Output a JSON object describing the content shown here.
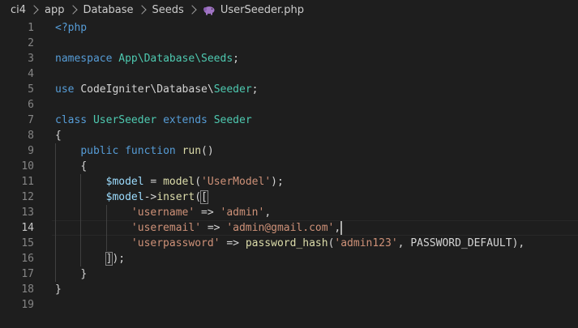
{
  "breadcrumb": {
    "items": [
      "ci4",
      "app",
      "Database",
      "Seeds"
    ],
    "file": "UserSeeder.php",
    "file_icon": "php-elephant-icon"
  },
  "colors": {
    "background": "#1e1e1e",
    "keyword": "#569cd6",
    "type": "#4ec9b0",
    "function": "#dcdcaa",
    "variable": "#9cdcfe",
    "string": "#ce9178",
    "text": "#d4d4d4",
    "line_number": "#858585"
  },
  "editor": {
    "current_line": 14,
    "lines": [
      {
        "n": "1",
        "tokens": [
          [
            "tag",
            "<?php"
          ]
        ]
      },
      {
        "n": "2",
        "tokens": []
      },
      {
        "n": "3",
        "tokens": [
          [
            "kw",
            "namespace"
          ],
          [
            "plain",
            " "
          ],
          [
            "ns",
            "App\\Database\\Seeds"
          ],
          [
            "punc",
            ";"
          ]
        ]
      },
      {
        "n": "4",
        "tokens": []
      },
      {
        "n": "5",
        "tokens": [
          [
            "kw",
            "use"
          ],
          [
            "plain",
            " "
          ],
          [
            "plain",
            "CodeIgniter\\Database\\"
          ],
          [
            "cls",
            "Seeder"
          ],
          [
            "punc",
            ";"
          ]
        ]
      },
      {
        "n": "6",
        "tokens": []
      },
      {
        "n": "7",
        "tokens": [
          [
            "kw",
            "class"
          ],
          [
            "plain",
            " "
          ],
          [
            "cls",
            "UserSeeder"
          ],
          [
            "plain",
            " "
          ],
          [
            "kw",
            "extends"
          ],
          [
            "plain",
            " "
          ],
          [
            "cls",
            "Seeder"
          ]
        ]
      },
      {
        "n": "8",
        "tokens": [
          [
            "punc",
            "{"
          ]
        ]
      },
      {
        "n": "9",
        "tokens": [
          [
            "plain",
            "    "
          ],
          [
            "kw",
            "public"
          ],
          [
            "plain",
            " "
          ],
          [
            "kw",
            "function"
          ],
          [
            "plain",
            " "
          ],
          [
            "fn",
            "run"
          ],
          [
            "punc",
            "()"
          ]
        ]
      },
      {
        "n": "10",
        "tokens": [
          [
            "plain",
            "    "
          ],
          [
            "punc",
            "{"
          ]
        ]
      },
      {
        "n": "11",
        "tokens": [
          [
            "plain",
            "        "
          ],
          [
            "var",
            "$model"
          ],
          [
            "plain",
            " = "
          ],
          [
            "fn",
            "model"
          ],
          [
            "punc",
            "("
          ],
          [
            "str",
            "'UserModel'"
          ],
          [
            "punc",
            ");"
          ]
        ]
      },
      {
        "n": "12",
        "tokens": [
          [
            "plain",
            "        "
          ],
          [
            "var",
            "$model"
          ],
          [
            "punc",
            "->"
          ],
          [
            "fn",
            "insert"
          ],
          [
            "punc",
            "("
          ],
          [
            "match",
            "["
          ]
        ]
      },
      {
        "n": "13",
        "tokens": [
          [
            "plain",
            "            "
          ],
          [
            "str",
            "'username'"
          ],
          [
            "plain",
            " => "
          ],
          [
            "str",
            "'admin'"
          ],
          [
            "punc",
            ","
          ]
        ]
      },
      {
        "n": "14",
        "tokens": [
          [
            "plain",
            "            "
          ],
          [
            "str",
            "'useremail'"
          ],
          [
            "plain",
            " => "
          ],
          [
            "str",
            "'admin@gmail.com'"
          ],
          [
            "punc",
            ","
          ],
          [
            "cursor",
            ""
          ]
        ]
      },
      {
        "n": "15",
        "tokens": [
          [
            "plain",
            "            "
          ],
          [
            "str",
            "'userpassword'"
          ],
          [
            "plain",
            " => "
          ],
          [
            "fn",
            "password_hash"
          ],
          [
            "punc",
            "("
          ],
          [
            "str",
            "'admin123'"
          ],
          [
            "punc",
            ", "
          ],
          [
            "const",
            "PASSWORD_DEFAULT"
          ],
          [
            "punc",
            "),"
          ]
        ]
      },
      {
        "n": "16",
        "tokens": [
          [
            "plain",
            "        "
          ],
          [
            "match",
            "]"
          ],
          [
            "punc",
            ");"
          ]
        ]
      },
      {
        "n": "17",
        "tokens": [
          [
            "plain",
            "    "
          ],
          [
            "punc",
            "}"
          ]
        ]
      },
      {
        "n": "18",
        "tokens": [
          [
            "punc",
            "}"
          ]
        ]
      },
      {
        "n": "19",
        "tokens": []
      }
    ]
  }
}
